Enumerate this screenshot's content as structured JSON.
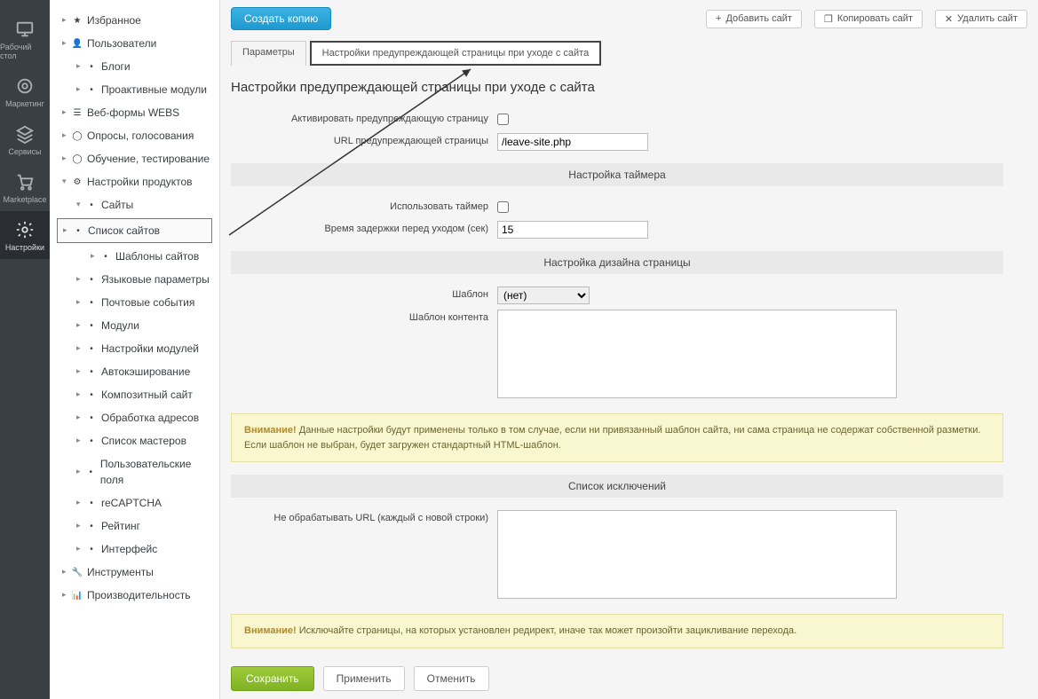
{
  "rail": [
    {
      "label": "Рабочий стол",
      "icon": "desktop"
    },
    {
      "label": "Маркетинг",
      "icon": "target"
    },
    {
      "label": "Сервисы",
      "icon": "stack"
    },
    {
      "label": "Marketplace",
      "icon": "cart"
    },
    {
      "label": "Настройки",
      "icon": "gear",
      "active": true
    }
  ],
  "tree": [
    {
      "label": "Избранное",
      "lvl": 0,
      "icon": "★"
    },
    {
      "label": "Пользователи",
      "lvl": 0,
      "icon": "👤"
    },
    {
      "label": "Блоги",
      "lvl": 1,
      "icon": "•"
    },
    {
      "label": "Проактивные модули",
      "lvl": 1,
      "icon": "•"
    },
    {
      "label": "Веб-формы WEBS",
      "lvl": 0,
      "icon": "☰"
    },
    {
      "label": "Опросы, голосования",
      "lvl": 0,
      "icon": "◯"
    },
    {
      "label": "Обучение, тестирование",
      "lvl": 0,
      "icon": "◯"
    },
    {
      "label": "Настройки продуктов",
      "lvl": 0,
      "icon": "⚙",
      "expanded": true
    },
    {
      "label": "Сайты",
      "lvl": 1,
      "icon": "•",
      "expanded": true
    },
    {
      "label": "Список сайтов",
      "lvl": 2,
      "icon": "•",
      "boxed": true
    },
    {
      "label": "Шаблоны сайтов",
      "lvl": 2,
      "icon": "•"
    },
    {
      "label": "Языковые параметры",
      "lvl": 1,
      "icon": "•"
    },
    {
      "label": "Почтовые события",
      "lvl": 1,
      "icon": "•"
    },
    {
      "label": "Модули",
      "lvl": 1,
      "icon": "•"
    },
    {
      "label": "Настройки модулей",
      "lvl": 1,
      "icon": "•"
    },
    {
      "label": "Автокэширование",
      "lvl": 1,
      "icon": "•"
    },
    {
      "label": "Композитный сайт",
      "lvl": 1,
      "icon": "•"
    },
    {
      "label": "Обработка адресов",
      "lvl": 1,
      "icon": "•"
    },
    {
      "label": "Список мастеров",
      "lvl": 1,
      "icon": "•"
    },
    {
      "label": "Пользовательские поля",
      "lvl": 1,
      "icon": "•"
    },
    {
      "label": "reCAPTCHA",
      "lvl": 1,
      "icon": "•"
    },
    {
      "label": "Рейтинг",
      "lvl": 1,
      "icon": "•"
    },
    {
      "label": "Интерфейс",
      "lvl": 1,
      "icon": "•"
    },
    {
      "label": "Инструменты",
      "lvl": 0,
      "icon": "🔧"
    },
    {
      "label": "Производительность",
      "lvl": 0,
      "icon": "📊"
    }
  ],
  "topbar": {
    "create": "Создать копию",
    "right": [
      {
        "label": "Добавить сайт",
        "icon": "+"
      },
      {
        "label": "Копировать сайт",
        "icon": "❐"
      },
      {
        "label": "Удалить сайт",
        "icon": "✕"
      }
    ]
  },
  "tabs": [
    {
      "label": "Параметры"
    },
    {
      "label": "Настройки предупреждающей страницы при уходе с сайта",
      "active": true
    }
  ],
  "heading": "Настройки предупреждающей страницы при уходе с сайта",
  "form": {
    "activate_label": "Активировать предупреждающую страницу",
    "url_label": "URL предупреждающей страницы",
    "url_value": "/leave-site.php",
    "section_timer": "Настройка таймера",
    "use_timer_label": "Использовать таймер",
    "delay_label": "Время задержки перед уходом (сек)",
    "delay_value": "15",
    "section_page": "Настройка дизайна страницы",
    "template_label": "Шаблон",
    "template_options": [
      "(нет)"
    ],
    "template_value": "(нет)",
    "content_label": "Шаблон контента",
    "content_value": "",
    "note1_strong": "Внимание!",
    "note1_body": " Данные настройки будут применены только в том случае, если ни привязанный шаблон сайта, ни сама страница не содержат собственной разметки. Если шаблон не выбран, будет загружен стандартный HTML-шаблон.",
    "section_exclude": "Список исключений",
    "exclude_label": "Не обрабатывать URL (каждый с новой строки)",
    "exclude_value": "",
    "note2_strong": "Внимание!",
    "note2_body": " Исключайте страницы, на которых установлен редирект, иначе так может произойти зацикливание перехода."
  },
  "buttons": {
    "save": "Сохранить",
    "apply": "Применить",
    "cancel": "Отменить"
  }
}
